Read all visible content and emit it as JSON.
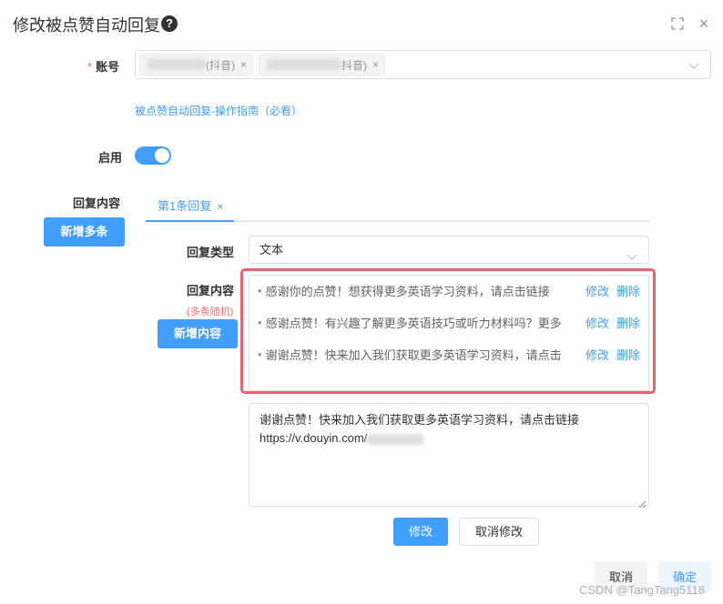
{
  "dialog": {
    "title": "修改被点赞自动回复",
    "help": "?",
    "close": "×"
  },
  "account": {
    "label": "账号",
    "required": "*",
    "tags": [
      {
        "suffix": "(抖音)",
        "close": "×"
      },
      {
        "suffix": "抖音)",
        "close": "×"
      }
    ]
  },
  "guide_link": "被点赞自动回复-操作指南（必看）",
  "enable": {
    "label": "启用",
    "on": true
  },
  "reply_content": {
    "label": "回复内容",
    "add_more_button": "新增多条",
    "tabs": [
      {
        "label": "第1条回复",
        "close": "×"
      }
    ]
  },
  "reply_type": {
    "label": "回复类型",
    "value": "文本"
  },
  "content": {
    "label": "回复内容",
    "note": "(多条随机)",
    "add_button": "新增内容",
    "items": [
      {
        "text": "感谢你的点赞！想获得更多英语学习资料，请点击链接",
        "edit": "修改",
        "delete": "删除"
      },
      {
        "text": "感谢点赞！有兴趣了解更多英语技巧或听力材料吗？更多",
        "edit": "修改",
        "delete": "删除"
      },
      {
        "text": "谢谢点赞！快来加入我们获取更多英语学习资料，请点击",
        "edit": "修改",
        "delete": "删除"
      }
    ],
    "editor_line1": "谢谢点赞！快来加入我们获取更多英语学习资料，请点击链接",
    "editor_line2": "https://v.douyin.com/"
  },
  "edit_actions": {
    "save": "修改",
    "cancel": "取消修改"
  },
  "footer": {
    "cancel": "取消",
    "confirm": "确定"
  },
  "watermark": "CSDN @TangTang5118",
  "colors": {
    "primary": "#409eff",
    "danger": "#f56c6c",
    "highlight": "#ec5f6c"
  }
}
